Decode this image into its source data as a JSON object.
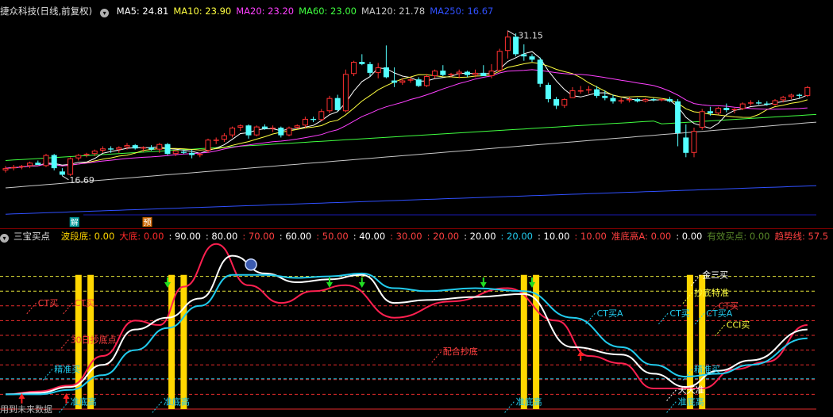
{
  "chart_data": [
    {
      "type": "candlestick",
      "title": "捷众科技(日线,前复权)",
      "legend": [
        {
          "label": "MA5: 24.81",
          "color": "#ffffff"
        },
        {
          "label": "MA10: 23.90",
          "color": "#ffff40"
        },
        {
          "label": "MA20: 23.20",
          "color": "#ff40ff"
        },
        {
          "label": "MA60: 23.00",
          "color": "#40ff40"
        },
        {
          "label": "MA120: 21.78",
          "color": "#c8c8c8"
        },
        {
          "label": "MA250: 16.67",
          "color": "#3050ff"
        }
      ],
      "annotations": [
        {
          "text": "31.15",
          "kind": "high"
        },
        {
          "text": "16.69",
          "kind": "low"
        }
      ],
      "markers": [
        "解",
        "预"
      ],
      "ylim": [
        15.5,
        32.5
      ],
      "candles": [
        [
          18.4,
          18.8,
          18.2,
          18.6
        ],
        [
          18.6,
          18.9,
          18.4,
          18.7
        ],
        [
          18.7,
          18.9,
          18.5,
          18.8
        ],
        [
          18.8,
          19.2,
          18.6,
          19.1
        ],
        [
          19.1,
          19.3,
          18.9,
          18.9
        ],
        [
          18.8,
          19.9,
          18.7,
          19.8
        ],
        [
          19.8,
          19.9,
          18.4,
          18.6
        ],
        [
          18.3,
          18.6,
          17.9,
          18.0
        ],
        [
          18.0,
          19.6,
          17.9,
          19.5
        ],
        [
          19.5,
          19.9,
          19.3,
          19.8
        ],
        [
          19.8,
          20.0,
          19.6,
          19.9
        ],
        [
          19.9,
          20.3,
          19.7,
          20.2
        ],
        [
          20.2,
          20.6,
          20.0,
          20.4
        ],
        [
          20.4,
          20.6,
          20.0,
          20.3
        ],
        [
          20.3,
          20.6,
          20.0,
          20.5
        ],
        [
          20.5,
          20.9,
          20.3,
          20.7
        ],
        [
          20.7,
          20.8,
          20.3,
          20.4
        ],
        [
          20.4,
          20.6,
          20.1,
          20.5
        ],
        [
          20.5,
          20.7,
          20.2,
          20.3
        ],
        [
          20.3,
          20.9,
          20.0,
          20.8
        ],
        [
          20.8,
          20.9,
          19.8,
          19.9
        ],
        [
          19.9,
          20.3,
          19.7,
          20.2
        ],
        [
          20.1,
          20.3,
          19.9,
          20.0
        ],
        [
          20.0,
          20.3,
          19.5,
          19.8
        ],
        [
          19.9,
          20.0,
          19.6,
          19.9
        ],
        [
          20.2,
          21.3,
          20.0,
          21.2
        ],
        [
          21.1,
          21.4,
          20.8,
          21.2
        ],
        [
          21.2,
          21.8,
          21.0,
          21.6
        ],
        [
          21.6,
          22.4,
          21.4,
          22.3
        ],
        [
          22.3,
          22.6,
          22.0,
          22.5
        ],
        [
          22.5,
          22.6,
          21.3,
          21.6
        ],
        [
          21.6,
          22.5,
          21.5,
          22.4
        ],
        [
          22.4,
          22.6,
          22.1,
          22.2
        ],
        [
          22.2,
          22.5,
          21.9,
          22.3
        ],
        [
          22.3,
          22.4,
          21.4,
          21.6
        ],
        [
          21.6,
          22.4,
          21.5,
          22.3
        ],
        [
          22.3,
          22.6,
          22.2,
          22.5
        ],
        [
          22.5,
          23.3,
          22.3,
          23.1
        ],
        [
          23.1,
          23.3,
          22.8,
          23.0
        ],
        [
          23.0,
          24.0,
          22.9,
          23.8
        ],
        [
          23.8,
          25.2,
          23.6,
          25.0
        ],
        [
          25.0,
          25.3,
          23.8,
          23.9
        ],
        [
          23.8,
          27.6,
          23.7,
          27.2
        ],
        [
          27.2,
          28.4,
          27.0,
          28.3
        ],
        [
          28.3,
          29.0,
          28.0,
          28.1
        ],
        [
          28.1,
          28.3,
          27.0,
          27.3
        ],
        [
          27.3,
          28.2,
          26.8,
          27.8
        ],
        [
          27.8,
          29.8,
          26.8,
          26.9
        ],
        [
          26.6,
          27.8,
          26.0,
          26.4
        ],
        [
          26.4,
          26.8,
          26.2,
          26.6
        ],
        [
          26.6,
          26.9,
          26.4,
          26.7
        ],
        [
          26.7,
          26.9,
          26.0,
          26.1
        ],
        [
          26.1,
          27.2,
          26.0,
          27.0
        ],
        [
          27.0,
          27.6,
          26.8,
          27.5
        ],
        [
          27.5,
          28.0,
          27.0,
          27.1
        ],
        [
          27.1,
          27.3,
          26.9,
          27.2
        ],
        [
          27.2,
          27.6,
          26.8,
          27.4
        ],
        [
          27.4,
          27.5,
          26.9,
          27.1
        ],
        [
          27.1,
          27.6,
          26.9,
          27.3
        ],
        [
          27.3,
          28.0,
          27.0,
          27.0
        ],
        [
          27.0,
          28.1,
          26.8,
          27.5
        ],
        [
          27.5,
          29.5,
          27.4,
          29.3
        ],
        [
          29.3,
          31.15,
          28.6,
          30.6
        ],
        [
          30.6,
          30.9,
          28.8,
          29.0
        ],
        [
          29.0,
          29.9,
          28.4,
          28.8
        ],
        [
          28.8,
          29.0,
          28.3,
          28.5
        ],
        [
          28.5,
          28.7,
          26.0,
          26.3
        ],
        [
          26.2,
          26.4,
          24.6,
          24.9
        ],
        [
          24.9,
          25.1,
          24.0,
          24.3
        ],
        [
          24.3,
          25.0,
          24.1,
          24.9
        ],
        [
          25.0,
          26.0,
          25.0,
          25.7
        ],
        [
          25.6,
          26.1,
          25.4,
          25.7
        ],
        [
          25.7,
          26.1,
          25.4,
          25.8
        ],
        [
          25.8,
          26.1,
          25.0,
          25.2
        ],
        [
          25.2,
          25.7,
          24.8,
          25.0
        ],
        [
          25.0,
          25.3,
          24.5,
          24.7
        ],
        [
          24.7,
          25.0,
          24.5,
          24.8
        ],
        [
          24.8,
          25.1,
          24.6,
          24.9
        ],
        [
          24.9,
          25.0,
          24.6,
          24.7
        ],
        [
          24.7,
          25.0,
          24.6,
          24.9
        ],
        [
          24.9,
          25.0,
          24.7,
          24.8
        ],
        [
          24.8,
          25.0,
          24.7,
          24.9
        ],
        [
          24.9,
          25.1,
          24.6,
          24.7
        ],
        [
          24.7,
          24.9,
          20.6,
          21.8
        ],
        [
          21.4,
          22.6,
          19.6,
          20.0
        ],
        [
          20.0,
          22.3,
          19.6,
          22.0
        ],
        [
          22.3,
          24.0,
          22.1,
          23.8
        ],
        [
          23.8,
          24.2,
          23.4,
          23.6
        ],
        [
          23.6,
          24.2,
          23.5,
          24.1
        ],
        [
          24.1,
          24.5,
          23.7,
          23.9
        ],
        [
          23.9,
          24.1,
          23.6,
          24.0
        ],
        [
          24.0,
          24.6,
          23.9,
          24.5
        ],
        [
          24.5,
          24.8,
          24.3,
          24.6
        ],
        [
          24.6,
          24.8,
          24.4,
          24.5
        ],
        [
          24.5,
          24.7,
          24.3,
          24.4
        ],
        [
          24.4,
          24.9,
          24.3,
          24.8
        ],
        [
          24.8,
          25.2,
          24.6,
          25.1
        ],
        [
          25.1,
          25.4,
          24.9,
          25.3
        ],
        [
          25.3,
          25.4,
          25.0,
          25.2
        ],
        [
          25.2,
          26.1,
          25.1,
          26.0
        ]
      ]
    },
    {
      "type": "line",
      "title": "三宝买点",
      "legend": [
        {
          "label": "波段底: 0.00",
          "color": "#ffd700"
        },
        {
          "label": "大底: 0.00",
          "color": "#ff2a2a"
        },
        {
          "label": ": 90.00",
          "color": "#ffffff"
        },
        {
          "label": ": 80.00",
          "color": "#ffffff"
        },
        {
          "label": ": 70.00",
          "color": "#ff4040"
        },
        {
          "label": ": 60.00",
          "color": "#ffffff"
        },
        {
          "label": ": 50.00",
          "color": "#ff4040"
        },
        {
          "label": ": 40.00",
          "color": "#ffffff"
        },
        {
          "label": ": 30.00",
          "color": "#ff4040"
        },
        {
          "label": ": 20.00",
          "color": "#ff4040"
        },
        {
          "label": ": 20.00",
          "color": "#ffffff"
        },
        {
          "label": ": 20.00",
          "color": "#22ccee"
        },
        {
          "label": ": 10.00",
          "color": "#ffffff"
        },
        {
          "label": ": 10.00",
          "color": "#ff4040"
        },
        {
          "label": "准底高A: 0.00",
          "color": "#ff4040"
        },
        {
          "label": ": 0.00",
          "color": "#ffffff"
        },
        {
          "label": "有效买点: 0.00",
          "color": "#5a8a2a"
        },
        {
          "label": "趋势线: 57.5",
          "color": "#ff4040"
        }
      ],
      "ylim": [
        0,
        100
      ],
      "levels": [
        {
          "value": 90,
          "color": "#ffff40",
          "dash": true
        },
        {
          "value": 80,
          "color": "#ffff40",
          "dash": true
        },
        {
          "value": 70,
          "color": "#ff3030",
          "dash": true
        },
        {
          "value": 60,
          "color": "#ff3030",
          "dash": true
        },
        {
          "value": 50,
          "color": "#ff3030",
          "dash": true
        },
        {
          "value": 40,
          "color": "#ff3030",
          "dash": true
        },
        {
          "value": 30,
          "color": "#ff3030",
          "dash": true
        },
        {
          "value": 20,
          "color": "#ff3030",
          "dash": true
        },
        {
          "value": 20,
          "color": "#22ccee",
          "dash": true
        },
        {
          "value": 10,
          "color": "#ff3030",
          "dash": true
        },
        {
          "value": 0,
          "color": "#ff3030",
          "dash": false
        }
      ],
      "series": [
        {
          "name": "",
          "color": "#ff2050",
          "x": [
            0,
            4,
            8,
            12,
            16,
            19,
            22,
            26,
            30,
            34,
            38,
            42,
            48,
            55,
            62,
            68,
            72,
            76,
            80,
            86,
            90,
            94,
            99
          ],
          "values": [
            10,
            12,
            16,
            36,
            60,
            57,
            83,
            112,
            84,
            72,
            80,
            84,
            62,
            73,
            82,
            60,
            36,
            31,
            14,
            14,
            27,
            32,
            57
          ]
        },
        {
          "name": "",
          "color": "#ffffff",
          "x": [
            0,
            4,
            8,
            12,
            16,
            20,
            24,
            28,
            32,
            36,
            40,
            44,
            48,
            52,
            58,
            64,
            70,
            76,
            80,
            84,
            88,
            92,
            99
          ],
          "values": [
            10,
            11,
            15,
            30,
            54,
            62,
            75,
            104,
            92,
            86,
            88,
            91,
            72,
            74,
            76,
            78,
            42,
            37,
            24,
            15,
            26,
            33,
            54
          ]
        },
        {
          "name": "",
          "color": "#22ccee",
          "x": [
            0,
            4,
            8,
            12,
            16,
            20,
            24,
            28,
            32,
            36,
            40,
            44,
            48,
            52,
            58,
            64,
            70,
            76,
            80,
            84,
            88,
            92,
            99
          ],
          "values": [
            10,
            10,
            13,
            23,
            40,
            55,
            70,
            91,
            91,
            89,
            90,
            92,
            82,
            80,
            82,
            80,
            62,
            42,
            30,
            22,
            24,
            30,
            48
          ]
        }
      ],
      "bars": [
        {
          "x": 9,
          "color": "#ffd700"
        },
        {
          "x": 10.5,
          "color": "#ffd700"
        },
        {
          "x": 20.5,
          "color": "#ffd700"
        },
        {
          "x": 22,
          "color": "#ffd700"
        },
        {
          "x": 64,
          "color": "#ffd700"
        },
        {
          "x": 65.5,
          "color": "#ffd700"
        },
        {
          "x": 84.5,
          "color": "#ffd700"
        },
        {
          "x": 86,
          "color": "#ffd700"
        }
      ],
      "labels": [
        {
          "text": "CT买",
          "x": 4,
          "y": 70,
          "color": "#ff4040"
        },
        {
          "text": "CT买",
          "x": 8.5,
          "y": 70,
          "color": "#ff4040"
        },
        {
          "text": "30日抄底点",
          "x": 8,
          "y": 45,
          "color": "#ff4040"
        },
        {
          "text": "精准买",
          "x": 6,
          "y": 25,
          "color": "#22ccee"
        },
        {
          "text": "准底高",
          "x": 8,
          "y": 3,
          "color": "#22ccee"
        },
        {
          "text": "准底高",
          "x": 19.5,
          "y": 3,
          "color": "#22ccee"
        },
        {
          "text": "配合抄底",
          "x": 54,
          "y": 37,
          "color": "#ff4040"
        },
        {
          "text": "准底高",
          "x": 63,
          "y": 3,
          "color": "#22ccee"
        },
        {
          "text": "CT买A",
          "x": 73,
          "y": 63,
          "color": "#22ccee"
        },
        {
          "text": "CT买",
          "x": 82,
          "y": 63,
          "color": "#22ccee"
        },
        {
          "text": "CT买A",
          "x": 86.5,
          "y": 63,
          "color": "#22ccee"
        },
        {
          "text": "金三买",
          "x": 86,
          "y": 89,
          "color": "#ffffff"
        },
        {
          "text": "抄底特准",
          "x": 85,
          "y": 77,
          "color": "#ffff40"
        },
        {
          "text": "CT买",
          "x": 88,
          "y": 68,
          "color": "#ff4040"
        },
        {
          "text": "CCI买",
          "x": 89,
          "y": 55,
          "color": "#ffff40"
        },
        {
          "text": "精准买",
          "x": 85,
          "y": 25,
          "color": "#22ccee"
        },
        {
          "text": "天天准",
          "x": 83,
          "y": 11,
          "color": "#ffffff"
        },
        {
          "text": "准底高",
          "x": 83,
          "y": 3,
          "color": "#22ccee"
        }
      ],
      "arrows_green": [
        20,
        40,
        44,
        59,
        65
      ],
      "arrows_red": [
        2,
        7.5,
        71
      ]
    }
  ],
  "footer": "用到未来数据"
}
